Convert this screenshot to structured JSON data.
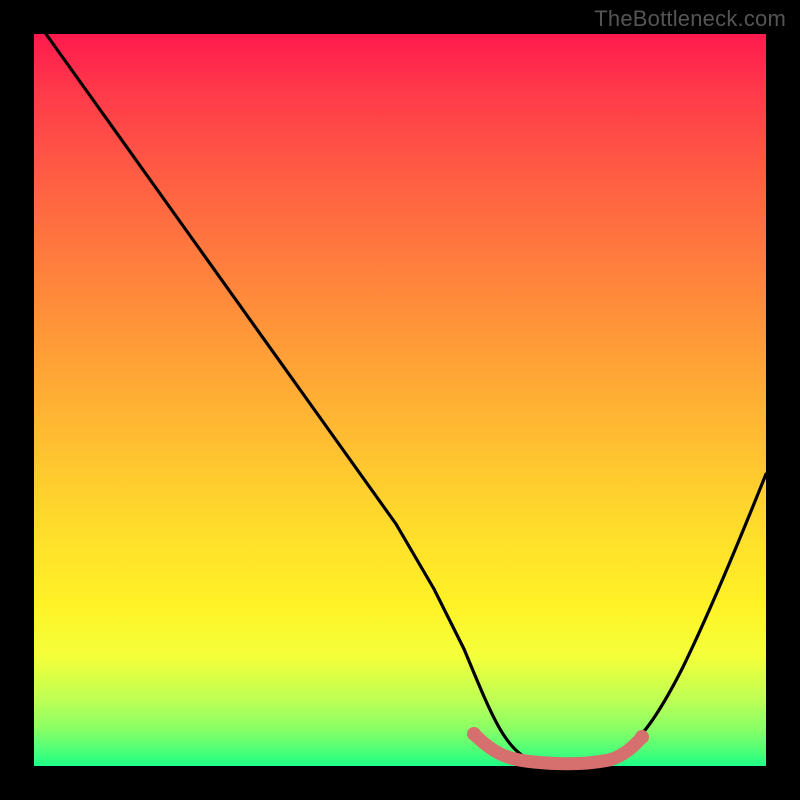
{
  "watermark": "TheBottleneck.com",
  "chart_data": {
    "type": "line",
    "title": "",
    "xlabel": "",
    "ylabel": "",
    "ylim": [
      0,
      100
    ],
    "x": [
      0.0,
      0.05,
      0.1,
      0.15,
      0.2,
      0.25,
      0.3,
      0.35,
      0.4,
      0.45,
      0.5,
      0.55,
      0.58,
      0.62,
      0.66,
      0.7,
      0.74,
      0.78,
      0.82,
      0.86,
      0.9,
      0.95,
      1.0
    ],
    "y": [
      100,
      92,
      84,
      76,
      68,
      60,
      52,
      44,
      36,
      28,
      20,
      12,
      6,
      2,
      0,
      0,
      0,
      1,
      4,
      10,
      19,
      30,
      42
    ],
    "series": [
      {
        "name": "bottleneck-curve",
        "color": "#000000"
      },
      {
        "name": "optimal-range-highlight",
        "color": "#d5706f",
        "x": [
          0.58,
          0.61,
          0.64,
          0.67,
          0.7,
          0.73,
          0.76,
          0.78
        ],
        "y": [
          2,
          1,
          0,
          0,
          0,
          0,
          1,
          3
        ]
      }
    ],
    "gradient_stops": [
      {
        "pos": 0.0,
        "color": "#ff1a4d"
      },
      {
        "pos": 0.5,
        "color": "#ffba32"
      },
      {
        "pos": 0.8,
        "color": "#fff226"
      },
      {
        "pos": 1.0,
        "color": "#1cff86"
      }
    ]
  }
}
